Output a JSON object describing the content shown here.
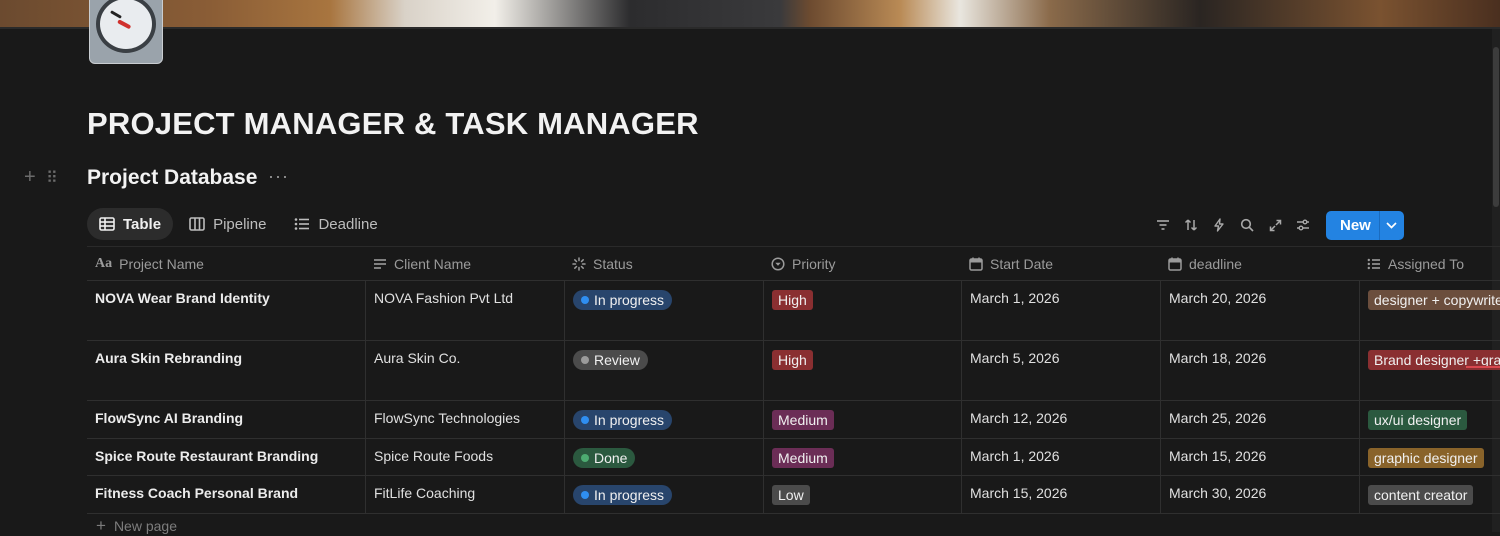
{
  "page": {
    "title": "PROJECT MANAGER & TASK MANAGER",
    "icon": "alarm-clock-icon"
  },
  "database": {
    "title": "Project Database",
    "more": "···"
  },
  "views": [
    {
      "label": "Table",
      "icon": "table-icon",
      "active": true
    },
    {
      "label": "Pipeline",
      "icon": "board-icon",
      "active": false
    },
    {
      "label": "Deadline",
      "icon": "list-icon",
      "active": false
    }
  ],
  "toolbar": {
    "icons": [
      "filter-icon",
      "sort-icon",
      "automation-icon",
      "search-icon",
      "expand-icon",
      "settings-icon"
    ],
    "new_label": "New"
  },
  "columns": [
    {
      "label": "Project Name",
      "icon": "title-icon"
    },
    {
      "label": "Client Name",
      "icon": "text-icon"
    },
    {
      "label": "Status",
      "icon": "status-icon"
    },
    {
      "label": "Priority",
      "icon": "select-icon"
    },
    {
      "label": "Start Date",
      "icon": "calendar-icon"
    },
    {
      "label": "deadline",
      "icon": "calendar-icon"
    },
    {
      "label": "Assigned To",
      "icon": "multiselect-icon"
    }
  ],
  "rows": [
    {
      "project": "NOVA Wear Brand Identity",
      "client": "NOVA Fashion Pvt Ltd",
      "status": "In progress",
      "priority": "High",
      "start": "March 1, 2026",
      "deadline": "March 20, 2026",
      "assigned": "designer + copywriter"
    },
    {
      "project": "Aura Skin Rebranding",
      "client": "Aura Skin Co.",
      "status": "Review",
      "priority": "High",
      "start": "March 5, 2026",
      "deadline": "March 18, 2026",
      "assigned": "Brand designer +graphic designer"
    },
    {
      "project": "FlowSync AI Branding",
      "client": "FlowSync Technologies",
      "status": "In progress",
      "priority": "Medium",
      "start": "March 12, 2026",
      "deadline": "March 25, 2026",
      "assigned": "ux/ui designer"
    },
    {
      "project": "Spice Route Restaurant Branding",
      "client": "Spice Route Foods",
      "status": "Done",
      "priority": "Medium",
      "start": "March 1, 2026",
      "deadline": "March 15, 2026",
      "assigned": "graphic designer"
    },
    {
      "project": "Fitness Coach Personal Brand",
      "client": "FitLife Coaching",
      "status": "In progress",
      "priority": "Low",
      "start": "March 15, 2026",
      "deadline": "March 30, 2026",
      "assigned": "content creator"
    }
  ],
  "status_colors": {
    "In progress": {
      "bg": "#28456c",
      "dot": "#2f8ef0"
    },
    "Review": {
      "bg": "#4b4b4b",
      "dot": "#9b9b9b"
    },
    "Done": {
      "bg": "#2b593f",
      "dot": "#4dab71"
    }
  },
  "priority_colors": {
    "High": "#8a2f31",
    "Medium": "#6b2d56",
    "Low": "#4b4b4b"
  },
  "assigned_colors": {
    "designer + copywriter": "#6b4e3d",
    "Brand designer +graphic designer": "#8a2f31",
    "ux/ui designer": "#2b593f",
    "graphic designer": "#89632a",
    "content creator": "#4b4b4b"
  },
  "footer": {
    "new_page": "New page"
  }
}
